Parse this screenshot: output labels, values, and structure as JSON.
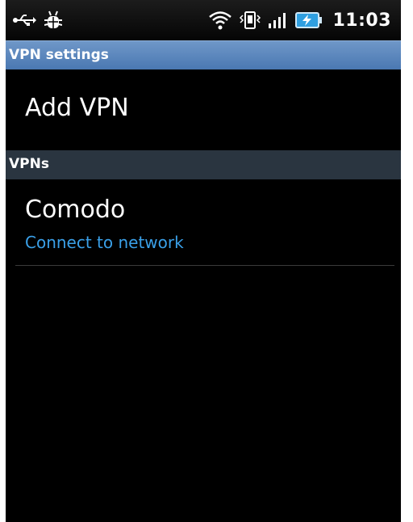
{
  "statusbar": {
    "left_icons": [
      "usb-icon",
      "debug-icon"
    ],
    "right_icons": [
      "wifi-icon",
      "vibrate-icon",
      "signal-icon",
      "battery-charging-icon"
    ],
    "time": "11:03",
    "colors": {
      "battery": "#2f9fe0"
    }
  },
  "titlebar": {
    "title": "VPN settings",
    "color": "#5a86bd"
  },
  "add_vpn": {
    "label": "Add VPN"
  },
  "section": {
    "label": "VPNs"
  },
  "vpns": [
    {
      "name": "Comodo",
      "status": "Connect to network"
    }
  ],
  "colors": {
    "status_text": "#3aa0e8",
    "background": "#000000"
  }
}
